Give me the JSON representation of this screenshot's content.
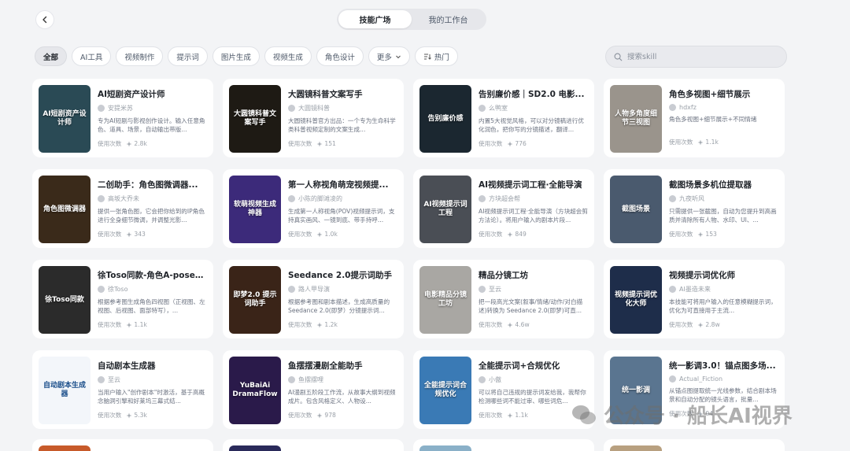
{
  "header": {
    "tabs": [
      {
        "label": "技能广场",
        "active": true
      },
      {
        "label": "我的工作台",
        "active": false
      }
    ]
  },
  "filters": {
    "chips": [
      "全部",
      "AI工具",
      "视频制作",
      "提示词",
      "图片生成",
      "视频生成",
      "角色设计"
    ],
    "more": "更多",
    "hot": "热门"
  },
  "search": {
    "placeholder": "搜索skill"
  },
  "usage_label": "使用次数",
  "cards": [
    {
      "title": "AI短剧资产设计师",
      "author": "安提米苏",
      "desc": "专为AI短剧与影视创作设计。输入任意角色、道具、场景，自动输出带版...",
      "uses": "2.8k",
      "thumb_text": "AI短剧资产设计师",
      "thumb_bg": "#2a4a55"
    },
    {
      "title": "大圆镜科普文案写手",
      "author": "大圆镜科普",
      "desc": "大圆镜科普官方出品：一个专为生命科学类科普视频定制的文案生成...",
      "uses": "151",
      "thumb_text": "大圆镜科普文案写手",
      "thumb_bg": "#1e1a14"
    },
    {
      "title": "告别廉价感｜SD2.0 电影...",
      "author": "么鸭室",
      "desc": "内置5大视觉风格，可以对分镜稿进行优化润色，把你写的分镜描述，翻译...",
      "uses": "776",
      "thumb_text": "告别廉价感",
      "thumb_bg": "#1b2730"
    },
    {
      "title": "角色多视图+细节展示",
      "author": "hdxfz",
      "desc": "角色多视图+细节展示+不同情绪",
      "uses": "1.1k",
      "thumb_text": "人物多角度细节三视图",
      "thumb_bg": "#9a948c"
    },
    {
      "title": "二创助手：角色图微调器...",
      "author": "高坂大乔未",
      "desc": "提供一张角色图，它会把你给到的IP角色进行全身细节微调，并调整光影...",
      "uses": "343",
      "thumb_text": "角色图微调器",
      "thumb_bg": "#3a2a1a"
    },
    {
      "title": "第一人称视角萌宠视频提...",
      "author": "小陈的脚滩凌的",
      "desc": "生成第一人称视角(POV)视频提示词，支持真实画风、一镜到底、带手持呼...",
      "uses": "1.0k",
      "thumb_text": "软萌视频生成神器",
      "thumb_bg": "#3c2a7a"
    },
    {
      "title": "AI视频提示词工程·全能导演",
      "author": "方块超会帮",
      "desc": "AI视频提示词工程·全能导演（方块超会剪方法论）。将用户输入的剧本片段...",
      "uses": "849",
      "thumb_text": "AI视频提示词工程",
      "thumb_bg": "#4a4e55"
    },
    {
      "title": "截图场景多机位提取器",
      "author": "九夜听风",
      "desc": "只需提供一张截图，自动为您提升到高画质并清除所有人物、水印、UI、...",
      "uses": "153",
      "thumb_text": "截图场景",
      "thumb_bg": "#4a5a6e"
    },
    {
      "title": "徐Toso同款-角色A-pose四...",
      "author": "徐Toso",
      "desc": "根据参考图生成角色四视图（正视图、左视图、后视图、面部特写），...",
      "uses": "1.1k",
      "thumb_text": "徐Toso同款",
      "thumb_bg": "#2b2b2b"
    },
    {
      "title": "Seedance 2.0提示词助手",
      "author": "路人甲导演",
      "desc": "根据参考图和剧本描述，生成高质量的 Seedance 2.0(即梦）分镜提示词...",
      "uses": "1.2k",
      "thumb_text": "即梦2.0 提示词助手",
      "thumb_bg": "#3a2418"
    },
    {
      "title": "精品分镜工坊",
      "author": "至云",
      "desc": "把一段高光文案(叙事/情绪/动作/对白描述)转换为 Seedance 2.0(即梦)可直...",
      "uses": "4.6w",
      "thumb_text": "电影精品分镜工坊",
      "thumb_bg": "#a9a7a3"
    },
    {
      "title": "视频提示词优化师",
      "author": "AI墨造未来",
      "desc": "本技能可将用户输入的任意模糊提示词，优化为可直接用于主流...",
      "uses": "2.8w",
      "thumb_text": "视频提示词优化大师",
      "thumb_bg": "#1e2d4a"
    },
    {
      "title": "自动剧本生成器",
      "author": "至云",
      "desc": "当用户输入\"创作剧本\"时激活，基于高概念脑洞引擎和好莱坞三幕式结...",
      "uses": "5.3k",
      "thumb_text": "自动剧本生成器",
      "thumb_bg": "#f3f6fa"
    },
    {
      "title": "鱼摆摆漫剧全能助手",
      "author": "鱼摆摆哩",
      "desc": "AI漫剧五阶段工作流，从故事大纲到视频成片。包含风格定义、人物设...",
      "uses": "978",
      "thumb_text": "YuBaiAi DramaFlow",
      "thumb_bg": "#2a1a4a"
    },
    {
      "title": "全能提示词+合规优化",
      "author": "小傲",
      "desc": "可以将自己违规的提示词发给我，我帮你检测哪些词不能过审、哪些词危...",
      "uses": "1.1k",
      "thumb_text": "全能提示词合规优化",
      "thumb_bg": "#3a7ab5"
    },
    {
      "title": "统一影调3.0！锚点图多场...",
      "author": "Actual_Fiction",
      "desc": "从锚点图提取统一光线参数，结合剧本场景和自动分配的镜头语言，批量...",
      "uses": "94",
      "thumb_text": "统一影调",
      "thumb_bg": "#5a7590"
    }
  ],
  "watermark": "公众号 · 船长AI视界"
}
